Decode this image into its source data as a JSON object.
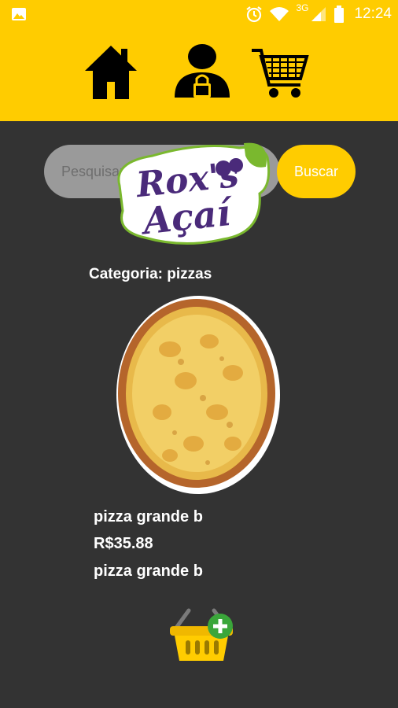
{
  "status_bar": {
    "network": "3G",
    "time": "12:24"
  },
  "header": {
    "icons": [
      "home-icon",
      "user-lock-icon",
      "shopping-cart-icon"
    ]
  },
  "search": {
    "placeholder": "Pesquisar...",
    "button_label": "Buscar"
  },
  "logo": {
    "line1": "Rox's",
    "line2": "Açaí"
  },
  "category": {
    "label": "Categoria: pizzas"
  },
  "product": {
    "name": "pizza grande b",
    "price": "R$35.88",
    "description": "pizza grande b"
  },
  "colors": {
    "accent": "#ffcc00",
    "background": "#333333",
    "logo_purple": "#4a2a7a",
    "logo_green": "#7ab82e"
  }
}
